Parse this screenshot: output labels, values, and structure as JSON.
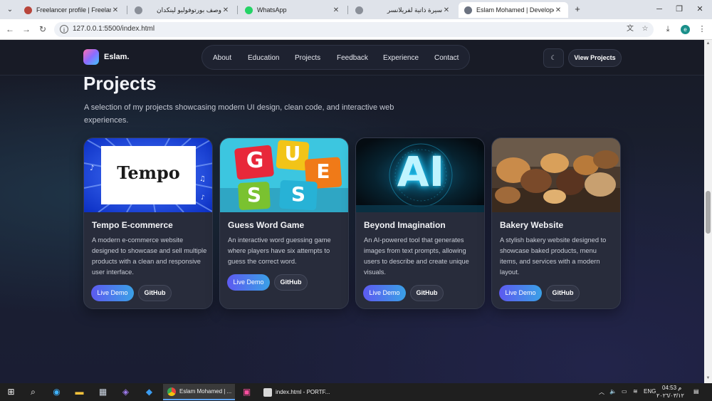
{
  "browser": {
    "tabs": [
      {
        "title": "Freelancer profile | Freelance W",
        "favicon_color": "#b8453b",
        "active": false
      },
      {
        "title": "وصف بورتوفوليو لينكدان",
        "favicon_color": "#8a8f98",
        "active": false
      },
      {
        "title": "WhatsApp",
        "favicon_color": "#25d366",
        "active": false
      },
      {
        "title": "سيرة ذاتية لفريلانسر",
        "favicon_color": "#8a8f98",
        "active": false
      },
      {
        "title": "Eslam Mohamed | Developer Po",
        "favicon_color": "#6b7280",
        "active": true
      }
    ],
    "url": "127.0.0.1:5500/index.html",
    "profile_initial": "e"
  },
  "site": {
    "logo": "Eslam.",
    "nav": [
      "About",
      "Education",
      "Projects",
      "Feedback",
      "Experience",
      "Contact"
    ],
    "theme_toggle_glyph": "☾",
    "cta": "View Projects"
  },
  "section": {
    "title": "Projects",
    "subtitle": "A selection of my projects showcasing modern UI design, clean code, and interactive web experiences."
  },
  "projects": [
    {
      "title": "Tempo E-commerce",
      "image_text": "Tempo",
      "description": "A modern e-commerce website designed to showcase and sell multiple products with a clean and responsive user interface.",
      "demo_label": "Live Demo",
      "github_label": "GitHub"
    },
    {
      "title": "Guess Word Game",
      "image_tiles": [
        "G",
        "U",
        "E",
        "S",
        "S"
      ],
      "description": "An interactive word guessing game where players have six attempts to guess the correct word.",
      "demo_label": "Live Demo",
      "github_label": "GitHub"
    },
    {
      "title": "Beyond Imagination",
      "image_text": "AI",
      "description": "An AI-powered tool that generates images from text prompts, allowing users to describe and create unique visuals.",
      "demo_label": "Live Demo",
      "github_label": "GitHub"
    },
    {
      "title": "Bakery Website",
      "description": "A stylish bakery website designed to showcase baked products, menu items, and services with a modern layout.",
      "demo_label": "Live Demo",
      "github_label": "GitHub"
    }
  ],
  "taskbar": {
    "windows": [
      {
        "title": "Eslam Mohamed | ...",
        "active": true
      },
      {
        "title": "index.html - PORTF...",
        "active": false
      }
    ],
    "language": "ENG",
    "time": "04:53 م",
    "date": "٢٠٢٦/٠٣/١٢"
  },
  "colors": {
    "accent_gradient_start": "#5d5af0",
    "accent_gradient_end": "#3aa0e6",
    "page_background": "#1a1e2c",
    "card_background": "#282c3b"
  }
}
